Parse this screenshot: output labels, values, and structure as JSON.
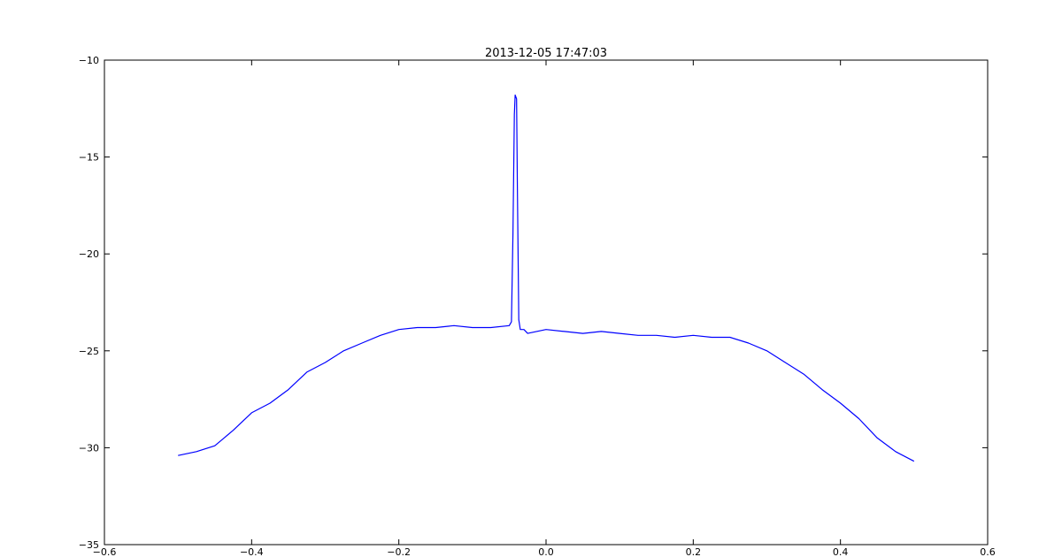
{
  "chart_data": {
    "type": "line",
    "title": "2013-12-05 17:47:03",
    "xlabel": "",
    "ylabel": "",
    "xlim": [
      -0.6,
      0.6
    ],
    "ylim": [
      -35,
      -10
    ],
    "xticks": [
      -0.6,
      -0.4,
      -0.2,
      0.0,
      0.2,
      0.4,
      0.6
    ],
    "xtick_labels": [
      "−0.6",
      "−0.4",
      "−0.2",
      "0.0",
      "0.2",
      "0.4",
      "0.6"
    ],
    "yticks": [
      -35,
      -30,
      -25,
      -20,
      -15,
      -10
    ],
    "ytick_labels": [
      "−35",
      "−30",
      "−25",
      "−20",
      "−15",
      "−10"
    ],
    "grid": false,
    "line_color": "#0000ff",
    "series": [
      {
        "x": [
          -0.5,
          -0.475,
          -0.45,
          -0.425,
          -0.4,
          -0.375,
          -0.35,
          -0.325,
          -0.3,
          -0.275,
          -0.25,
          -0.225,
          -0.2,
          -0.175,
          -0.15,
          -0.125,
          -0.1,
          -0.075,
          -0.05,
          -0.047,
          -0.045,
          -0.043,
          -0.042,
          -0.04,
          -0.039,
          -0.037,
          -0.035,
          -0.03,
          -0.025,
          0.0,
          0.025,
          0.05,
          0.075,
          0.1,
          0.125,
          0.15,
          0.175,
          0.2,
          0.225,
          0.25,
          0.275,
          0.3,
          0.325,
          0.35,
          0.375,
          0.4,
          0.425,
          0.45,
          0.475,
          0.5
        ],
        "y": [
          -30.4,
          -30.2,
          -29.9,
          -29.1,
          -28.2,
          -27.7,
          -27.0,
          -26.1,
          -25.6,
          -25.0,
          -24.6,
          -24.2,
          -23.9,
          -23.8,
          -23.8,
          -23.7,
          -23.8,
          -23.8,
          -23.7,
          -23.5,
          -19.0,
          -12.8,
          -11.8,
          -12.0,
          -16.5,
          -23.4,
          -23.9,
          -23.9,
          -24.1,
          -23.9,
          -24.0,
          -24.1,
          -24.0,
          -24.1,
          -24.2,
          -24.2,
          -24.3,
          -24.2,
          -24.3,
          -24.3,
          -24.6,
          -25.0,
          -25.6,
          -26.2,
          -27.0,
          -27.7,
          -28.5,
          -29.5,
          -30.2,
          -30.7
        ]
      }
    ]
  }
}
